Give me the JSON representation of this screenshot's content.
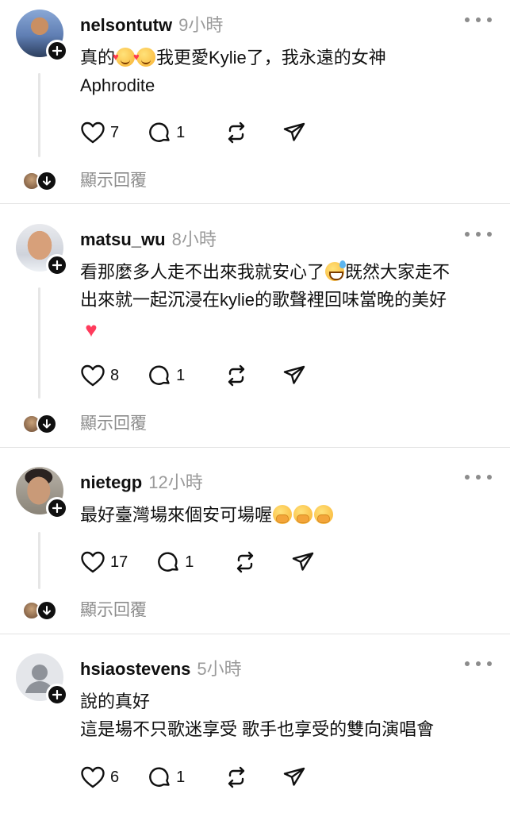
{
  "posts": [
    {
      "username": "nelsontutw",
      "time": "9小時",
      "lines": [
        [
          {
            "t": "text",
            "v": "真的"
          },
          {
            "t": "emoji",
            "name": "smiling-face-with-hearts-icon",
            "c": "heart-face"
          },
          {
            "t": "emoji",
            "name": "smiling-face-with-hearts-icon",
            "c": "heart-face"
          },
          {
            "t": "text",
            "v": "我更愛Kylie了，我永遠的女神"
          }
        ],
        [
          {
            "t": "text",
            "v": "Aphrodite"
          }
        ]
      ],
      "likes": "7",
      "comments": "1",
      "show_replies": "顯示回覆"
    },
    {
      "username": "matsu_wu",
      "time": "8小時",
      "lines": [
        [
          {
            "t": "text",
            "v": "看那麼多人走不出來我就安心了"
          },
          {
            "t": "emoji",
            "name": "grinning-sweat-icon",
            "c": "sweat"
          },
          {
            "t": "text",
            "v": "既然大家走不"
          }
        ],
        [
          {
            "t": "text",
            "v": "出來就一起沉浸在kylie的歌聲裡回味當晚的美好"
          }
        ],
        [
          {
            "t": "emoji",
            "name": "red-heart-icon",
            "c": "heart",
            "glyph": "♥"
          }
        ]
      ],
      "likes": "8",
      "comments": "1",
      "show_replies": "顯示回覆"
    },
    {
      "username": "nietegp",
      "time": "12小時",
      "lines": [
        [
          {
            "t": "text",
            "v": "最好臺灣場來個安可場喔"
          },
          {
            "t": "emoji",
            "name": "face-with-hand-over-mouth-icon",
            "c": "hush"
          },
          {
            "t": "emoji",
            "name": "face-with-hand-over-mouth-icon",
            "c": "hush"
          },
          {
            "t": "emoji",
            "name": "face-with-hand-over-mouth-icon",
            "c": "hush"
          }
        ]
      ],
      "likes": "17",
      "comments": "1",
      "show_replies": "顯示回覆"
    },
    {
      "username": "hsiaostevens",
      "time": "5小時",
      "lines": [
        [
          {
            "t": "text",
            "v": "說的真好"
          }
        ],
        [
          {
            "t": "text",
            "v": "這是場不只歌迷享受 歌手也享受的雙向演唱會"
          }
        ]
      ],
      "likes": "6",
      "comments": "1",
      "show_replies": ""
    }
  ],
  "colors": {
    "text": "#101010",
    "muted": "#9a9a9a",
    "separator": "#e3e3e3",
    "emoji_heart": "#ff3b5c"
  }
}
